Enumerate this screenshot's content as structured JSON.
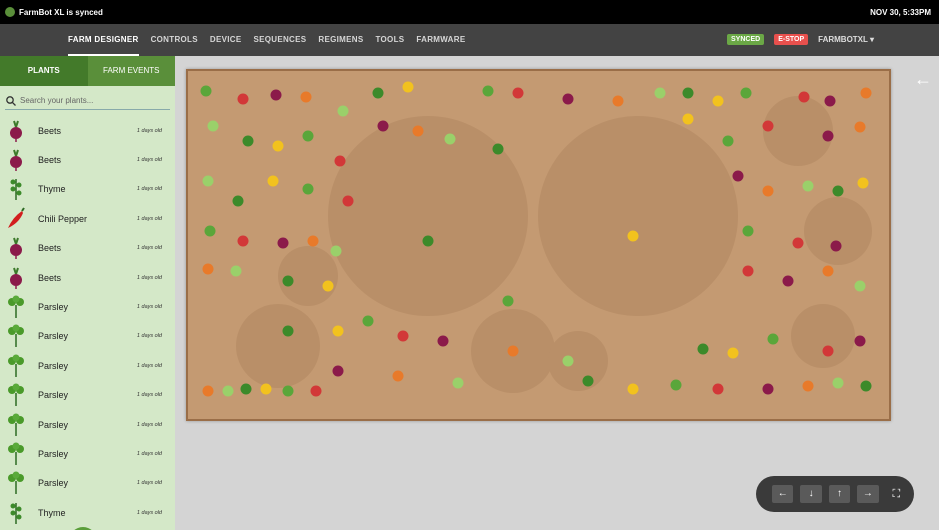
{
  "os": {
    "title": "FarmBot XL is synced",
    "time": "NOV 30, 5:33PM"
  },
  "nav": {
    "tabs": [
      "FARM DESIGNER",
      "CONTROLS",
      "DEVICE",
      "SEQUENCES",
      "REGIMENS",
      "TOOLS",
      "FARMWARE"
    ],
    "synced": "SYNCED",
    "estop": "E-STOP",
    "bot": "FARMBOTXL ▾"
  },
  "sidebar": {
    "tabs": [
      "PLANTS",
      "FARM EVENTS"
    ],
    "search_placeholder": "Search your plants...",
    "plants": [
      {
        "name": "Beets",
        "age": "1 days old",
        "icon": "beet-icon"
      },
      {
        "name": "Beets",
        "age": "1 days old",
        "icon": "beet-icon"
      },
      {
        "name": "Thyme",
        "age": "1 days old",
        "icon": "thyme-icon"
      },
      {
        "name": "Chili Pepper",
        "age": "1 days old",
        "icon": "pepper-icon"
      },
      {
        "name": "Beets",
        "age": "1 days old",
        "icon": "beet-icon"
      },
      {
        "name": "Beets",
        "age": "1 days old",
        "icon": "beet-icon"
      },
      {
        "name": "Parsley",
        "age": "1 days old",
        "icon": "parsley-icon"
      },
      {
        "name": "Parsley",
        "age": "1 days old",
        "icon": "parsley-icon"
      },
      {
        "name": "Parsley",
        "age": "1 days old",
        "icon": "parsley-icon"
      },
      {
        "name": "Parsley",
        "age": "1 days old",
        "icon": "parsley-icon"
      },
      {
        "name": "Parsley",
        "age": "1 days old",
        "icon": "parsley-icon"
      },
      {
        "name": "Parsley",
        "age": "1 days old",
        "icon": "parsley-icon"
      },
      {
        "name": "Parsley",
        "age": "1 days old",
        "icon": "parsley-icon"
      },
      {
        "name": "Thyme",
        "age": "1 days old",
        "icon": "thyme-icon"
      }
    ],
    "add_label": "+"
  },
  "controls": {
    "left": "←",
    "down": "↓",
    "up": "↑",
    "right": "→",
    "fullscreen": "⛶"
  },
  "back": "←"
}
